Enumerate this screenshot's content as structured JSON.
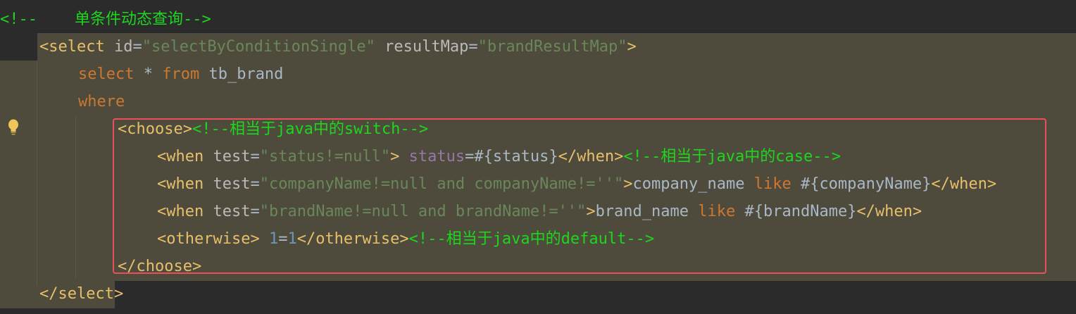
{
  "lines": [
    {
      "id": "line-comment-title",
      "segments": [
        {
          "c": "cmt",
          "t": "<!--    单条件动态查询-->"
        }
      ]
    },
    {
      "id": "line-select-open",
      "segments": [
        {
          "c": "tag",
          "t": "<select"
        },
        {
          "c": "plain",
          "t": " "
        },
        {
          "c": "attr",
          "t": "id"
        },
        {
          "c": "plain",
          "t": "="
        },
        {
          "c": "str",
          "t": "\"selectByConditionSingle\""
        },
        {
          "c": "plain",
          "t": " "
        },
        {
          "c": "attr",
          "t": "resultMap"
        },
        {
          "c": "plain",
          "t": "="
        },
        {
          "c": "str",
          "t": "\"brandResultMap\""
        },
        {
          "c": "tag",
          "t": ">"
        }
      ]
    },
    {
      "id": "line-sql-select",
      "segments": [
        {
          "c": "kw",
          "t": "select"
        },
        {
          "c": "plain",
          "t": " * "
        },
        {
          "c": "kw",
          "t": "from"
        },
        {
          "c": "plain",
          "t": " tb_brand"
        }
      ]
    },
    {
      "id": "line-sql-where",
      "segments": [
        {
          "c": "kw",
          "t": "where"
        }
      ]
    },
    {
      "id": "line-choose-open",
      "segments": [
        {
          "c": "tag",
          "t": "<choose>"
        },
        {
          "c": "cmt",
          "t": "<!--相当于java中的switch-->"
        }
      ]
    },
    {
      "id": "line-when-status",
      "segments": [
        {
          "c": "tag",
          "t": "<when"
        },
        {
          "c": "plain",
          "t": " "
        },
        {
          "c": "attr",
          "t": "test"
        },
        {
          "c": "plain",
          "t": "="
        },
        {
          "c": "str",
          "t": "\"status!=null\""
        },
        {
          "c": "tag",
          "t": ">"
        },
        {
          "c": "plain",
          "t": " "
        },
        {
          "c": "field",
          "t": "status"
        },
        {
          "c": "plain",
          "t": "=#{status}"
        },
        {
          "c": "tag",
          "t": "</when>"
        },
        {
          "c": "cmt",
          "t": "<!--相当于java中的case-->"
        }
      ]
    },
    {
      "id": "line-when-company",
      "segments": [
        {
          "c": "tag",
          "t": "<when"
        },
        {
          "c": "plain",
          "t": " "
        },
        {
          "c": "attr",
          "t": "test"
        },
        {
          "c": "plain",
          "t": "="
        },
        {
          "c": "str",
          "t": "\"companyName!=null and companyName!=''\""
        },
        {
          "c": "tag",
          "t": ">"
        },
        {
          "c": "plain",
          "t": "company_name "
        },
        {
          "c": "kw",
          "t": "like"
        },
        {
          "c": "plain",
          "t": " #{companyName}"
        },
        {
          "c": "tag",
          "t": "</when>"
        }
      ]
    },
    {
      "id": "line-when-brand",
      "segments": [
        {
          "c": "tag",
          "t": "<when"
        },
        {
          "c": "plain",
          "t": " "
        },
        {
          "c": "attr",
          "t": "test"
        },
        {
          "c": "plain",
          "t": "="
        },
        {
          "c": "str",
          "t": "\"brandName!=null and brandName!=''\""
        },
        {
          "c": "tag",
          "t": ">"
        },
        {
          "c": "plain",
          "t": "brand_name "
        },
        {
          "c": "kw",
          "t": "like"
        },
        {
          "c": "plain",
          "t": " #{brandName}"
        },
        {
          "c": "tag",
          "t": "</when>"
        }
      ]
    },
    {
      "id": "line-otherwise",
      "segments": [
        {
          "c": "tag",
          "t": "<otherwise>"
        },
        {
          "c": "plain",
          "t": " "
        },
        {
          "c": "num",
          "t": "1"
        },
        {
          "c": "plain",
          "t": "="
        },
        {
          "c": "num",
          "t": "1"
        },
        {
          "c": "tag",
          "t": "</otherwise>"
        },
        {
          "c": "cmt",
          "t": "<!--相当于java中的default-->"
        }
      ]
    },
    {
      "id": "line-choose-close",
      "segments": [
        {
          "c": "tag",
          "t": "</choose>"
        }
      ]
    },
    {
      "id": "line-select-close",
      "segments": [
        {
          "c": "tag",
          "t": "</select>"
        }
      ]
    }
  ],
  "theme": {
    "editor_background": "#2b2b2b",
    "injected_block_background": "#4e4b3d",
    "highlight_border": "#e8505b",
    "bulb_color": "#f2c55c"
  },
  "gutter_icon": "lightbulb-icon"
}
